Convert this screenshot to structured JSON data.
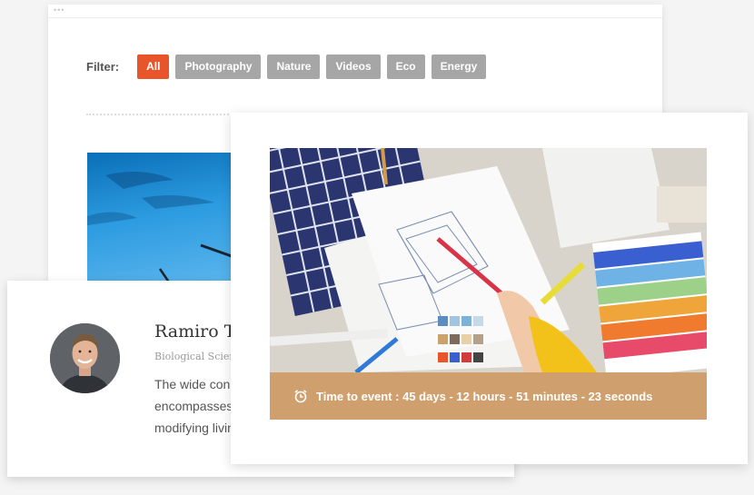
{
  "filter": {
    "label": "Filter:",
    "buttons": [
      "All",
      "Photography",
      "Nature",
      "Videos",
      "Eco",
      "Energy"
    ],
    "active_index": 0,
    "active_color": "#e8552a",
    "inactive_color": "#a6a6a6"
  },
  "testimonial": {
    "name": "Ramiro Ty",
    "role": "Biological Scien",
    "quote_lines": [
      "The wide con",
      "encompasses",
      "modifying livin"
    ]
  },
  "event": {
    "countdown_label": "Time to event : 45 days - 12 hours - 51 minutes - 23 seconds",
    "bar_color": "#cfa06e",
    "icon": "alarm-clock-icon"
  }
}
